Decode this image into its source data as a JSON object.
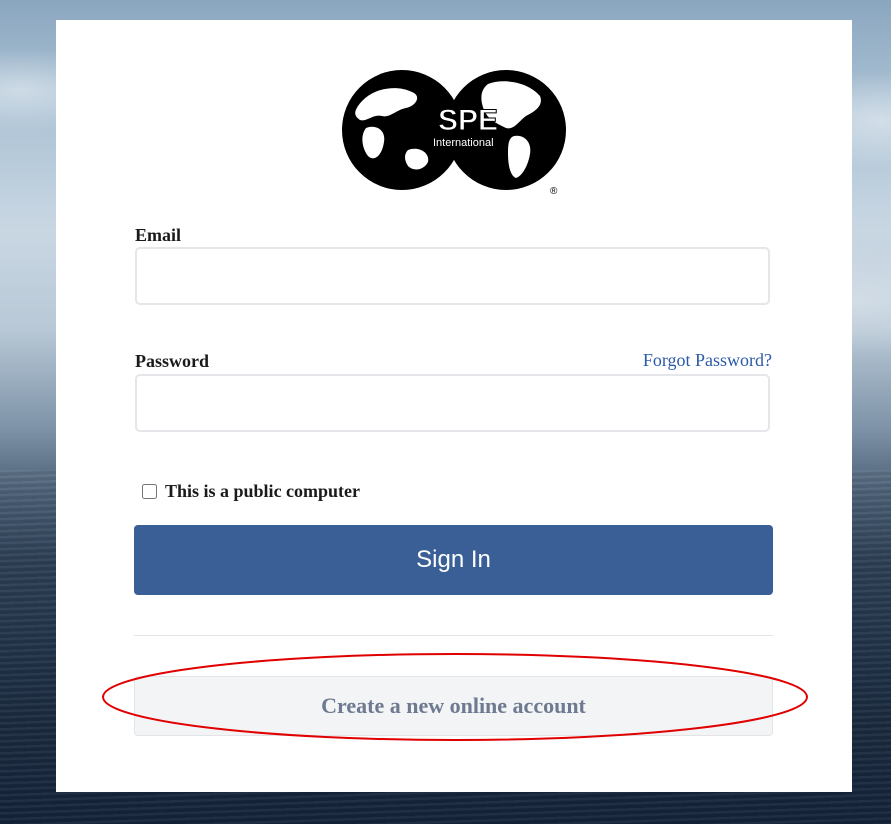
{
  "logo": {
    "main_text": "SPE",
    "sub_text": "International",
    "registered_mark": "®"
  },
  "form": {
    "email_label": "Email",
    "email_value": "",
    "password_label": "Password",
    "password_value": "",
    "forgot_link": "Forgot Password?",
    "public_computer_label": "This is a public computer",
    "public_computer_checked": false,
    "sign_in_label": "Sign In",
    "create_account_label": "Create a new online account"
  },
  "colors": {
    "primary_button": "#3a5f97",
    "link": "#2b5aa8",
    "secondary_text": "#6d7a90",
    "annotation": "#e00000"
  }
}
